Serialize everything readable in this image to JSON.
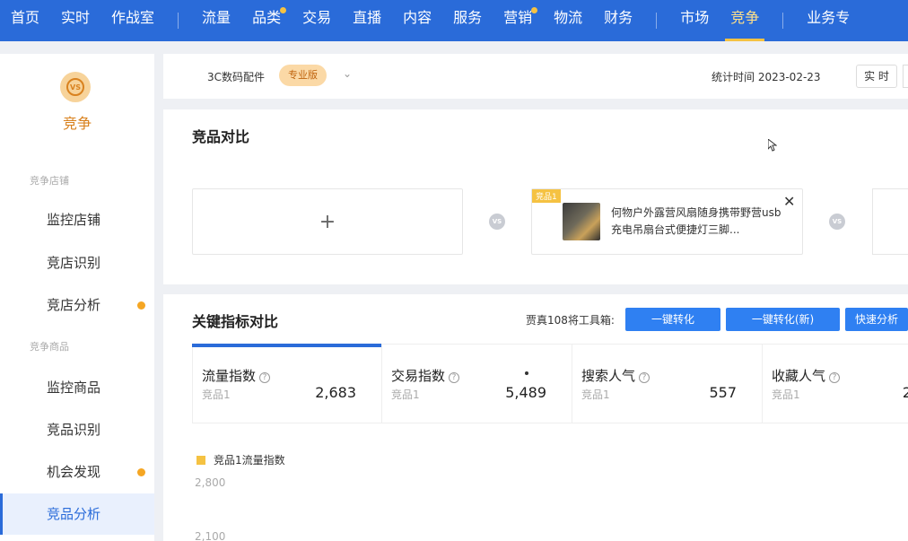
{
  "nav": {
    "items": [
      {
        "label": "首页"
      },
      {
        "label": "实时"
      },
      {
        "label": "作战室"
      },
      {
        "label": "流量"
      },
      {
        "label": "品类"
      },
      {
        "label": "交易"
      },
      {
        "label": "直播"
      },
      {
        "label": "内容"
      },
      {
        "label": "服务"
      },
      {
        "label": "营销"
      },
      {
        "label": "物流"
      },
      {
        "label": "财务"
      },
      {
        "label": "市场"
      },
      {
        "label": "竞争"
      },
      {
        "label": "业务专"
      }
    ]
  },
  "sidebar": {
    "logo_text": "VS",
    "title": "竞争",
    "group1": "竞争店铺",
    "group2": "竞争商品",
    "items": [
      {
        "label": "监控店铺"
      },
      {
        "label": "竞店识别"
      },
      {
        "label": "竞店分析"
      },
      {
        "label": "监控商品"
      },
      {
        "label": "竞品识别"
      },
      {
        "label": "机会发现"
      },
      {
        "label": "竞品分析"
      }
    ]
  },
  "topbar": {
    "category": "3C数码配件",
    "badge": "专业版",
    "chevron": "⌄",
    "stat_time": "统计时间 2023-02-23",
    "realtime_btn": "实 时"
  },
  "compare": {
    "title": "竞品对比",
    "add_symbol": "+",
    "vs": "VS",
    "product": {
      "tag": "竞品1",
      "name": "何物户外露营风扇随身携带野营usb充电吊扇台式便捷灯三脚...",
      "close": "✕"
    }
  },
  "metrics": {
    "title": "关键指标对比",
    "tool_label": "贾真108将工具箱:",
    "buttons": [
      "一键转化",
      "一键转化(新)",
      "快速分析"
    ],
    "cells": [
      {
        "name": "流量指数",
        "sub": "竞品1",
        "value": "2,683"
      },
      {
        "name": "交易指数",
        "sub": "竞品1",
        "value": "5,489"
      },
      {
        "name": "搜索人气",
        "sub": "竞品1",
        "value": "557"
      },
      {
        "name": "收藏人气",
        "sub": "竞品1",
        "value": "2"
      }
    ],
    "help": "?"
  },
  "chart_data": {
    "type": "line",
    "series": [
      {
        "name": "竞品1流量指数",
        "values": []
      }
    ],
    "y_ticks": [
      "2,800",
      "2,100"
    ],
    "color": "#f5c242"
  }
}
